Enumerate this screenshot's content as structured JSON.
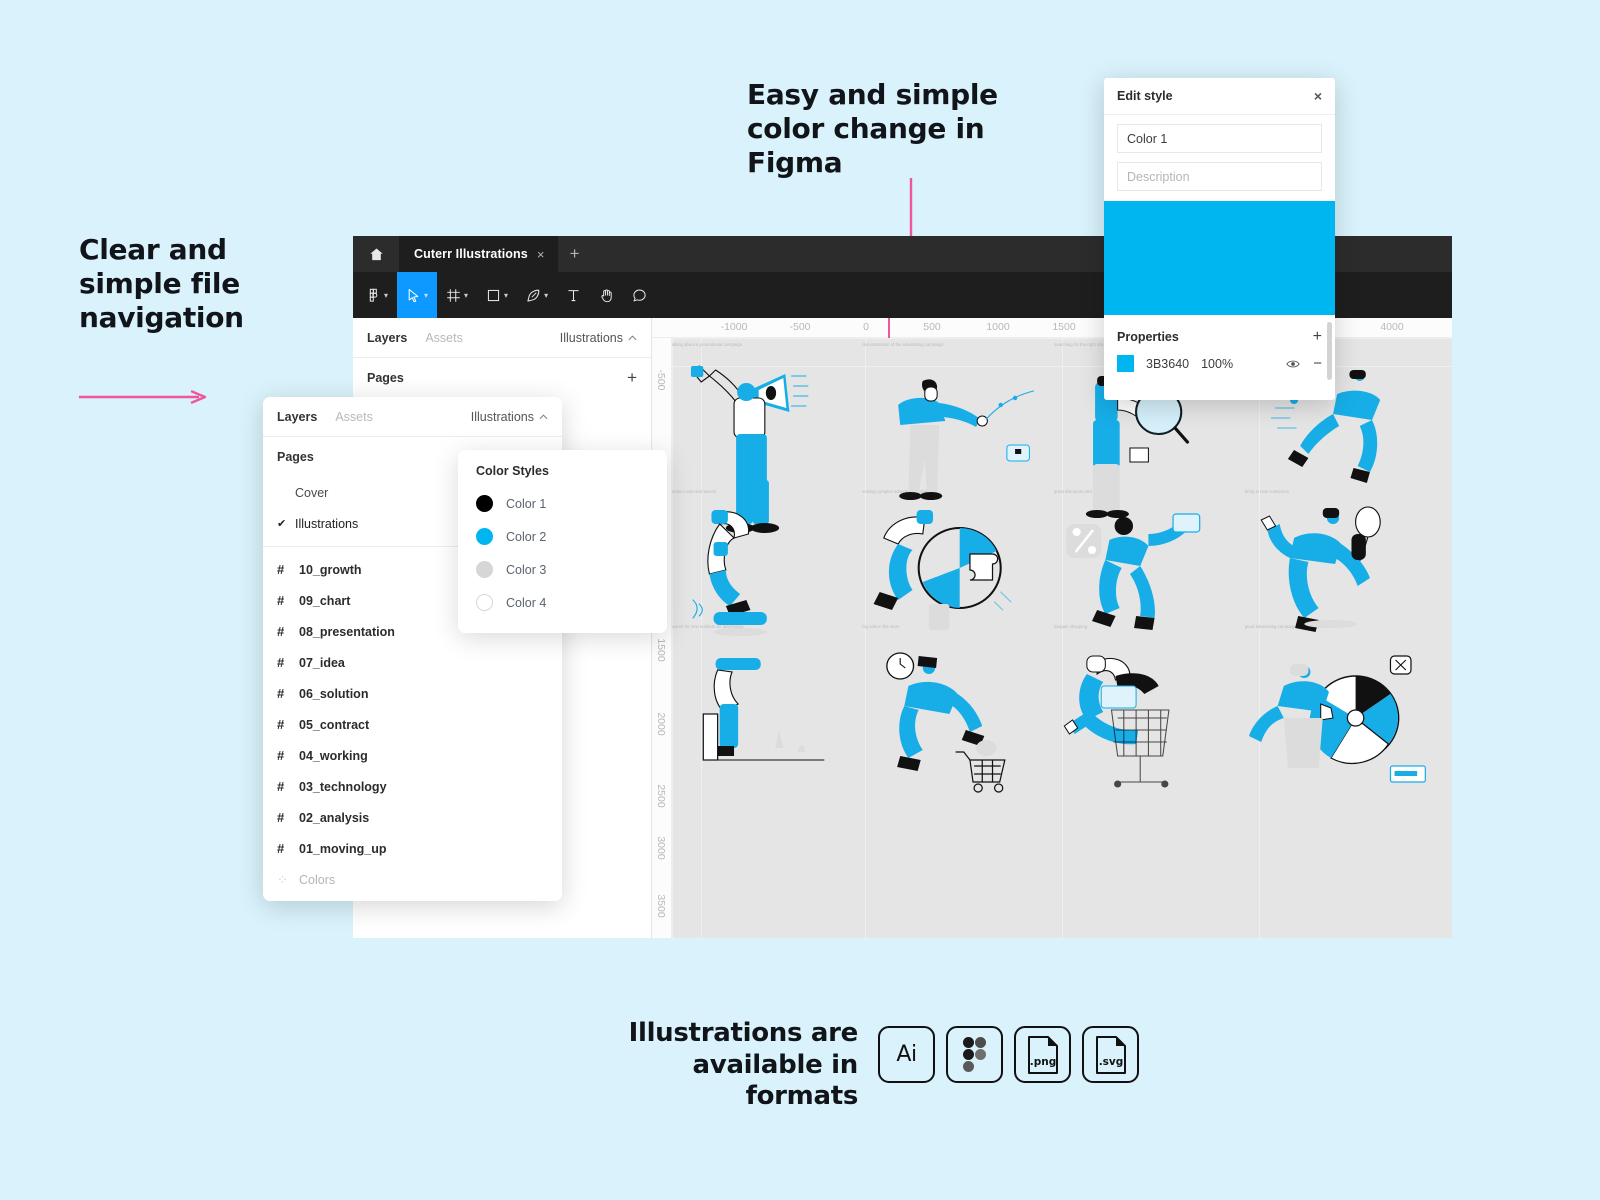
{
  "page": {
    "background_color": "#d9f2fb",
    "accent_pink": "#f0569b",
    "figma_blue": "#0d99ff"
  },
  "annotations": {
    "nav": "Clear and simple file navigation",
    "color": "Easy and simple color change in Figma",
    "formats": "Illustrations are available in formats"
  },
  "figma": {
    "tab": {
      "title": "Cuterr Illustrations",
      "close": "×",
      "add": "+"
    },
    "toolbar_tools": [
      {
        "name": "figma-menu-tool",
        "glyph": "menu",
        "chevron": true,
        "active": false
      },
      {
        "name": "move-tool",
        "glyph": "cursor",
        "chevron": true,
        "active": true
      },
      {
        "name": "frame-tool",
        "glyph": "frame",
        "chevron": true,
        "active": false
      },
      {
        "name": "shape-tool",
        "glyph": "square",
        "chevron": true,
        "active": false
      },
      {
        "name": "pen-tool",
        "glyph": "pen",
        "chevron": true,
        "active": false
      },
      {
        "name": "text-tool",
        "glyph": "text",
        "chevron": false,
        "active": false
      },
      {
        "name": "hand-tool",
        "glyph": "hand",
        "chevron": false,
        "active": false
      },
      {
        "name": "comment-tool",
        "glyph": "comment",
        "chevron": false,
        "active": false
      }
    ],
    "panel": {
      "tab_layers": "Layers",
      "tab_assets": "Assets",
      "current_page": "Illustrations",
      "pages_label": "Pages",
      "add_page": "+"
    },
    "pages": [
      {
        "label": "Cover",
        "selected": false
      },
      {
        "label": "Illustrations",
        "selected": true
      }
    ],
    "layers": [
      {
        "label": "10_growth",
        "icon": "hash-icon",
        "muted": false
      },
      {
        "label": "09_chart",
        "icon": "hash-icon",
        "muted": false
      },
      {
        "label": "08_presentation",
        "icon": "hash-icon",
        "muted": false
      },
      {
        "label": "07_idea",
        "icon": "hash-icon",
        "muted": false
      },
      {
        "label": "06_solution",
        "icon": "hash-icon",
        "muted": false
      },
      {
        "label": "05_contract",
        "icon": "hash-icon",
        "muted": false
      },
      {
        "label": "04_working",
        "icon": "hash-icon",
        "muted": false
      },
      {
        "label": "03_technology",
        "icon": "hash-icon",
        "muted": false
      },
      {
        "label": "02_analysis",
        "icon": "hash-icon",
        "muted": false
      },
      {
        "label": "01_moving_up",
        "icon": "hash-icon",
        "muted": false
      },
      {
        "label": "Colors",
        "icon": "component-icon",
        "muted": true
      }
    ],
    "ruler_h": [
      "-1000",
      "-500",
      "0",
      "500",
      "1000",
      "1500",
      "4000"
    ],
    "ruler_v": [
      "-500",
      "1500",
      "2000",
      "2500",
      "3000",
      "3500"
    ],
    "frame_labels": [
      "talking about a promotional campaign",
      "demonstration of the advertising campaign",
      "searching for the right solution",
      "bring in new customers",
      "product sale and launch",
      "solving complex advertising problems",
      "great discounts and promotions",
      "bring in new customers",
      "search for new markets for advertising",
      "big sale in the store",
      "bargain shopping",
      "good advertising campaign performance"
    ]
  },
  "color_styles": {
    "title": "Color Styles",
    "items": [
      {
        "label": "Color 1",
        "hex": "#000000",
        "border": "none"
      },
      {
        "label": "Color 2",
        "hex": "#00b6f0",
        "border": "none"
      },
      {
        "label": "Color 3",
        "hex": "#d6d6d6",
        "border": "none"
      },
      {
        "label": "Color 4",
        "hex": "#ffffff",
        "border": "1px solid #d8d8d8"
      }
    ]
  },
  "edit_style": {
    "title": "Edit style",
    "close": "×",
    "name_value": "Color 1",
    "description_placeholder": "Description",
    "preview_color": "#00b6f0",
    "properties_label": "Properties",
    "add": "+",
    "remove": "−",
    "property": {
      "hex": "3B3640",
      "swatch_color": "#00b6f0",
      "opacity": "100%",
      "visibility_icon": "eye-icon"
    }
  },
  "formats": [
    {
      "name": "ai",
      "label": "Ai"
    },
    {
      "name": "figma",
      "label": ""
    },
    {
      "name": "png",
      "label": ".png"
    },
    {
      "name": "svg",
      "label": ".svg"
    }
  ]
}
